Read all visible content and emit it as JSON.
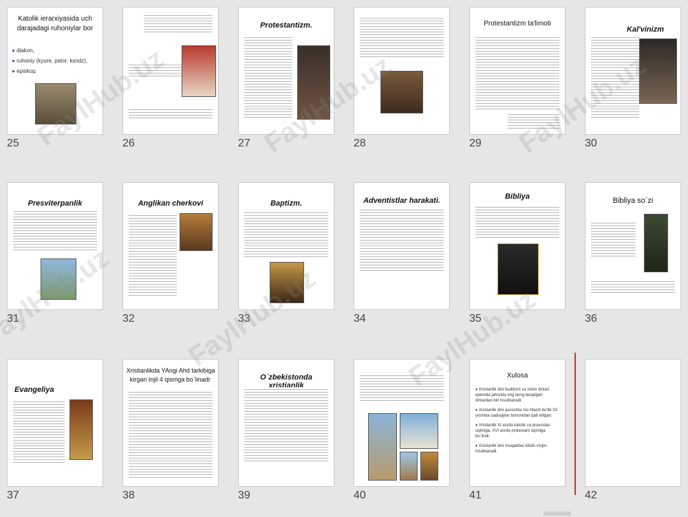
{
  "watermark_text": "FaylHub.uz",
  "slides": [
    {
      "number": "25",
      "title": "Katolik ierarxiyasida uch darajadagi ruhoniylar bor",
      "list": [
        "diakon,",
        "ruhoniy (kyure, pator, ksndz),",
        "episkop."
      ]
    },
    {
      "number": "26",
      "title": "",
      "list": []
    },
    {
      "number": "27",
      "title": "Protestantizm.",
      "list": []
    },
    {
      "number": "28",
      "title": "",
      "list": []
    },
    {
      "number": "29",
      "title": "Protestantizm ta'limoti",
      "list": []
    },
    {
      "number": "30",
      "title": "Kal'vinizm",
      "list": []
    },
    {
      "number": "31",
      "title": "Presviterpanlik",
      "list": []
    },
    {
      "number": "32",
      "title": "Anglikan cherkovi",
      "list": []
    },
    {
      "number": "33",
      "title": "Baptizm.",
      "list": []
    },
    {
      "number": "34",
      "title": "Adventistlar harakati.",
      "list": []
    },
    {
      "number": "35",
      "title": "Bibliya",
      "list": []
    },
    {
      "number": "36",
      "title": "Bibliya so`zi",
      "list": []
    },
    {
      "number": "37",
      "title": "Evangeliya",
      "list": []
    },
    {
      "number": "38",
      "title": "Xristianlikda YAngi Ahd tarkibiga kirgan Injil 4 qismga bo`linadi:",
      "list": []
    },
    {
      "number": "39",
      "title": "O`zbekistonda xristianlik",
      "list": []
    },
    {
      "number": "40",
      "title": "",
      "list": []
    },
    {
      "number": "41",
      "title": "Xulosa",
      "list": [
        "Xristianlik dini buddizm va islom dinlari qatorida jahonda eng keng tarqalgan dinlardan biri hisoblanadi.",
        "Xristianlik dini asoschisi Iso Masih bo'lib 33 yoshida saduqiylar tomonidan qatl etilgan.",
        "Xristianlik XI asrda katolik va pravoslav oqimiga, XVI asrda protestant oqimiga bo`lindi.",
        "Xristianlik dini muqaddas kitobi «Injil» hisoblanadi."
      ]
    },
    {
      "number": "42",
      "title": "",
      "list": []
    }
  ]
}
